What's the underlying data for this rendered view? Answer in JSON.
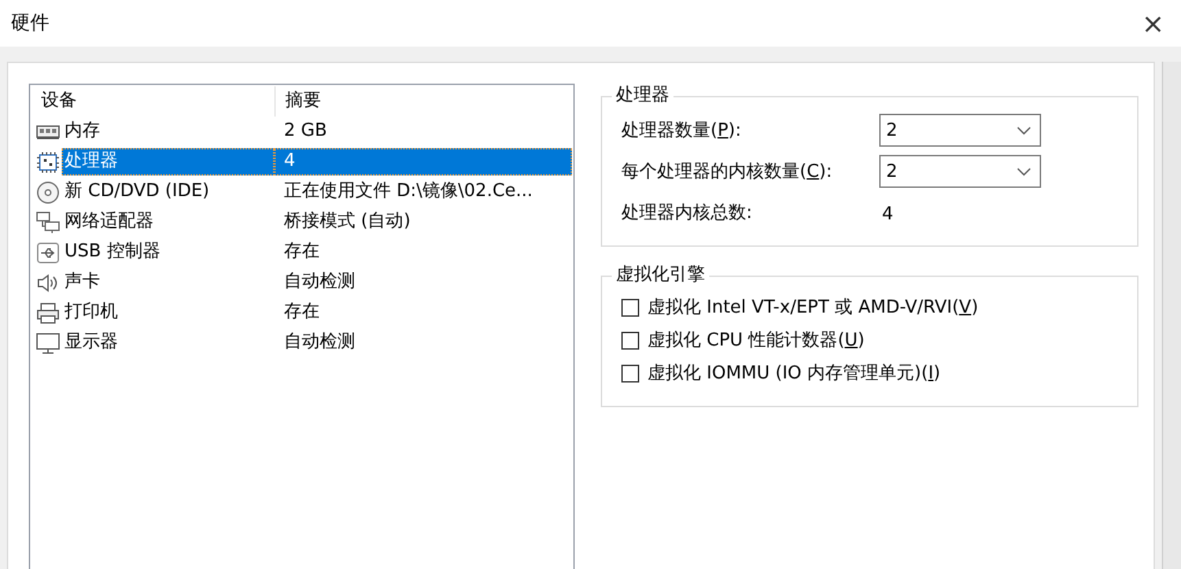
{
  "window": {
    "title": "硬件",
    "close_glyph": "×"
  },
  "device_list": {
    "columns": [
      "设备",
      "摘要"
    ],
    "rows": [
      {
        "kind": "memory",
        "device": "内存",
        "summary": "2 GB",
        "selected": false
      },
      {
        "kind": "cpu",
        "device": "处理器",
        "summary": "4",
        "selected": true
      },
      {
        "kind": "cd",
        "device": "新 CD/DVD (IDE)",
        "summary": "正在使用文件 D:\\镜像\\02.Ce...",
        "selected": false
      },
      {
        "kind": "network",
        "device": "网络适配器",
        "summary": "桥接模式 (自动)",
        "selected": false
      },
      {
        "kind": "usb",
        "device": "USB 控制器",
        "summary": "存在",
        "selected": false
      },
      {
        "kind": "sound",
        "device": "声卡",
        "summary": "自动检测",
        "selected": false
      },
      {
        "kind": "printer",
        "device": "打印机",
        "summary": "存在",
        "selected": false
      },
      {
        "kind": "display",
        "device": "显示器",
        "summary": "自动检测",
        "selected": false
      }
    ]
  },
  "processor_group": {
    "title": "处理器",
    "fields": [
      {
        "label_start": "处理器数量(",
        "access_key": "P",
        "label_end": "):",
        "value": "2"
      },
      {
        "label_start": "每个处理器的内核数量(",
        "access_key": "C",
        "label_end": "):",
        "value": "2"
      }
    ],
    "total": {
      "label": "处理器内核总数:",
      "value": "4"
    }
  },
  "virtualization_group": {
    "title": "虚拟化引擎",
    "options": [
      {
        "label_start": "虚拟化 Intel VT-x/EPT 或 AMD-V/RVI(",
        "access_key": "V",
        "label_end": ")",
        "checked": false
      },
      {
        "label_start": "虚拟化 CPU 性能计数器(",
        "access_key": "U",
        "label_end": ")",
        "checked": false
      },
      {
        "label_start": "虚拟化 IOMMU (IO 内存管理单元)(",
        "access_key": "I",
        "label_end": ")",
        "checked": false
      }
    ]
  }
}
